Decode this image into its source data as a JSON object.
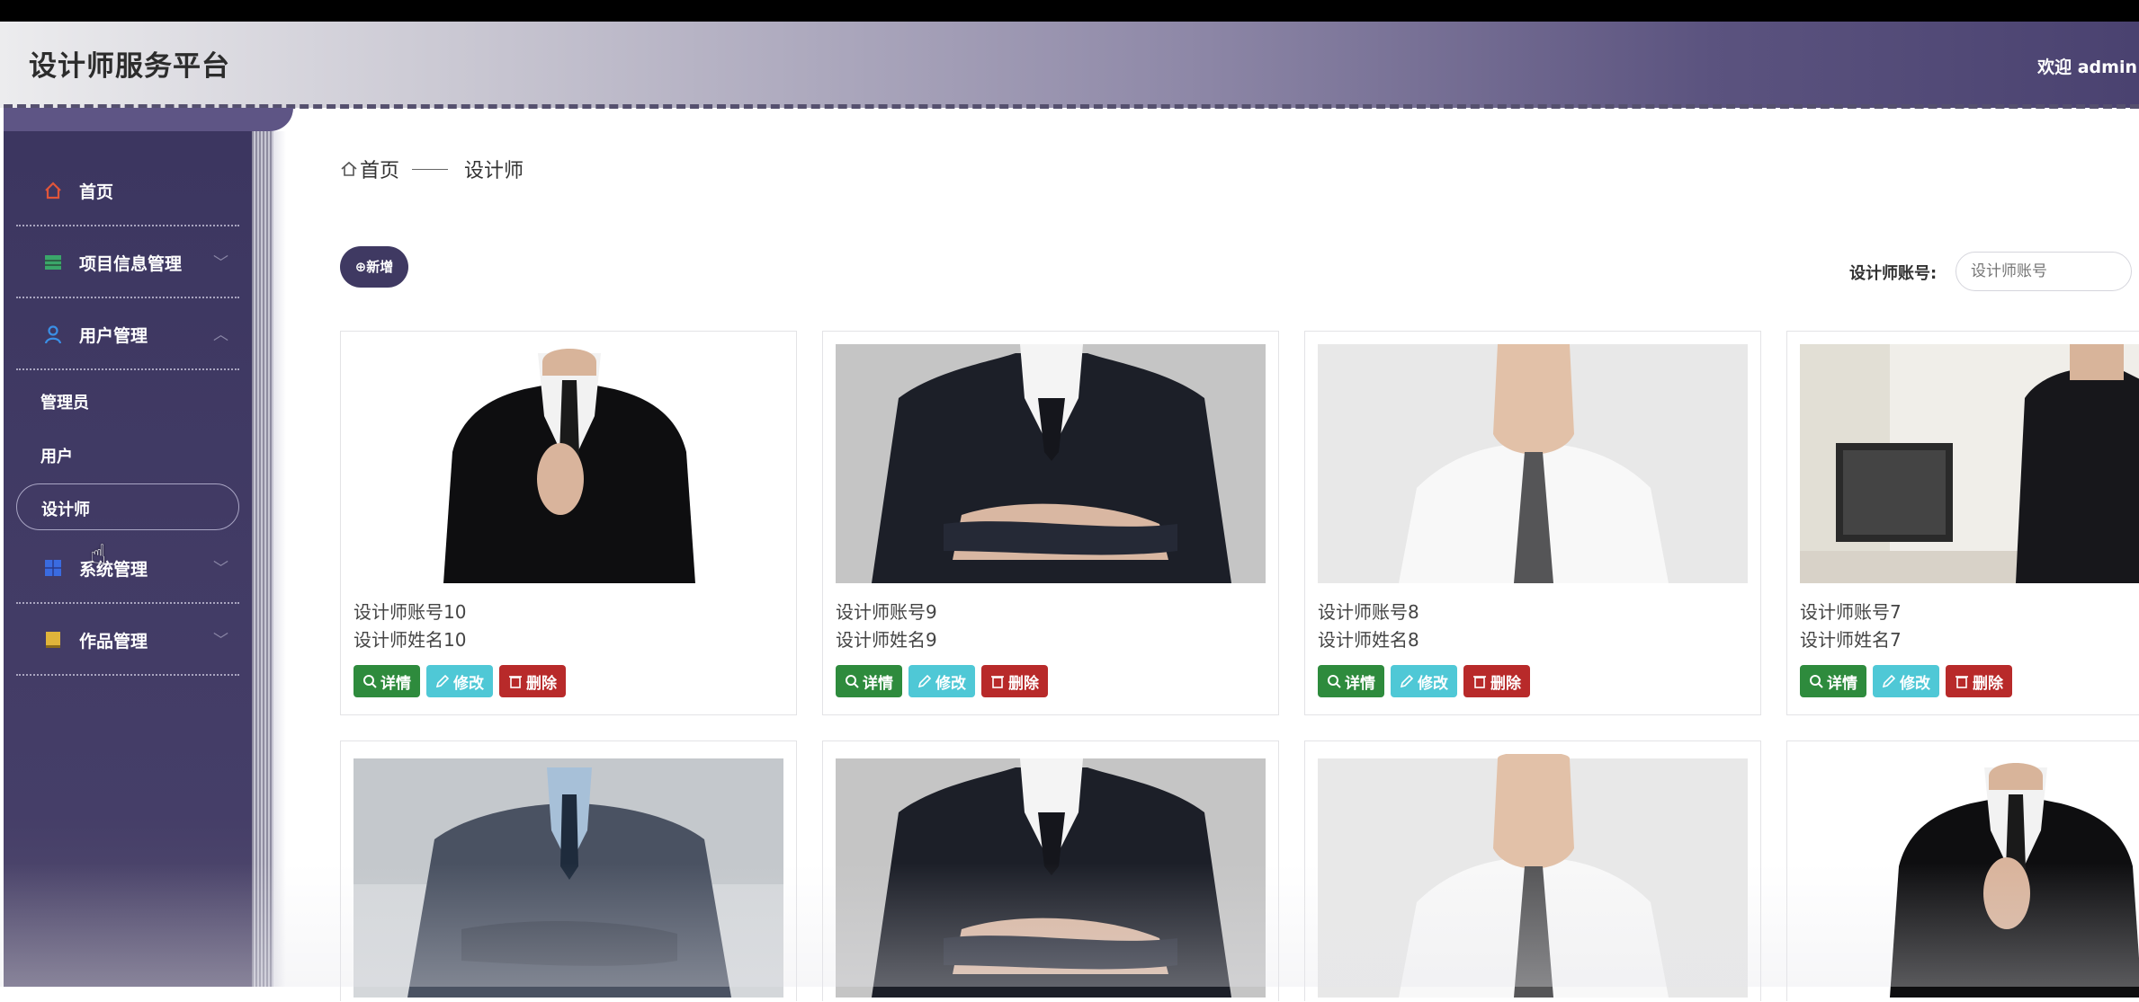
{
  "app": {
    "title": "设计师服务平台",
    "welcome": "欢迎 admin"
  },
  "sidebar": {
    "items": [
      {
        "label": "首页",
        "icon": "home-icon",
        "color": "#e0553a"
      },
      {
        "label": "项目信息管理",
        "icon": "table-icon",
        "color": "#3aa66a",
        "chevron": "﹀"
      },
      {
        "label": "用户管理",
        "icon": "user-icon",
        "color": "#3a8fe6",
        "chevron": "︿"
      },
      {
        "label": "系统管理",
        "icon": "system-icon",
        "color": "#3a6be0",
        "chevron": "﹀"
      },
      {
        "label": "作品管理",
        "icon": "book-icon",
        "color": "#e0b43a",
        "chevron": "﹀"
      }
    ],
    "subitems": [
      "管理员",
      "用户",
      "设计师"
    ]
  },
  "breadcrumb": {
    "home": "首页",
    "current": "设计师"
  },
  "toolbar": {
    "add_label": "⊕新增",
    "search_label": "设计师账号:",
    "search_placeholder": "设计师账号"
  },
  "cards": [
    {
      "account": "设计师账号10",
      "name": "设计师姓名10",
      "photo": "suit-black-closeup"
    },
    {
      "account": "设计师账号9",
      "name": "设计师姓名9",
      "photo": "pinstripe-arms-crossed"
    },
    {
      "account": "设计师账号8",
      "name": "设计师姓名8",
      "photo": "white-shirt-gray-tie"
    },
    {
      "account": "设计师账号7",
      "name": "设计师姓名7",
      "photo": "office-suit"
    }
  ],
  "bottom_cards": [
    {
      "photo": "gray-suit-arms-crossed"
    },
    {
      "photo": "pinstripe-arms-crossed"
    },
    {
      "photo": "white-shirt-gray-tie"
    },
    {
      "photo": "suit-black-closeup"
    }
  ],
  "buttons": {
    "detail": "详情",
    "edit": "修改",
    "delete": "删除"
  },
  "colors": {
    "sidebar": "#3c3660",
    "detail": "#2e8b3d",
    "edit": "#4fc8d6",
    "delete": "#b82a2a"
  }
}
